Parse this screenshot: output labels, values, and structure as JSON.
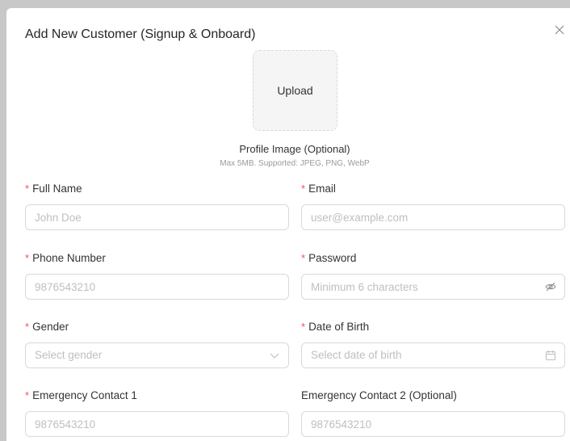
{
  "modal": {
    "title": "Add New Customer (Signup & Onboard)",
    "close_icon": "close-icon"
  },
  "upload": {
    "button_label": "Upload",
    "profile_label": "Profile Image (Optional)",
    "hint": "Max 5MB. Supported: JPEG, PNG, WebP"
  },
  "form": {
    "required_mark": "*",
    "full_name": {
      "label": "Full Name",
      "placeholder": "John Doe",
      "value": ""
    },
    "email": {
      "label": "Email",
      "placeholder": "user@example.com",
      "value": ""
    },
    "phone": {
      "label": "Phone Number",
      "placeholder": "9876543210",
      "value": ""
    },
    "password": {
      "label": "Password",
      "placeholder": "Minimum 6 characters",
      "value": "",
      "suffix_icon": "eye-invisible-icon"
    },
    "gender": {
      "label": "Gender",
      "placeholder": "Select gender",
      "suffix_icon": "chevron-down-icon"
    },
    "dob": {
      "label": "Date of Birth",
      "placeholder": "Select date of birth",
      "suffix_icon": "calendar-icon"
    },
    "emergency1": {
      "label": "Emergency Contact 1",
      "placeholder": "9876543210",
      "value": ""
    },
    "emergency2": {
      "label": "Emergency Contact 2 (Optional)",
      "placeholder": "9876543210",
      "value": ""
    }
  },
  "colors": {
    "required": "#ff4d4f",
    "placeholder": "#bfbfbf",
    "border": "#d9d9d9"
  }
}
